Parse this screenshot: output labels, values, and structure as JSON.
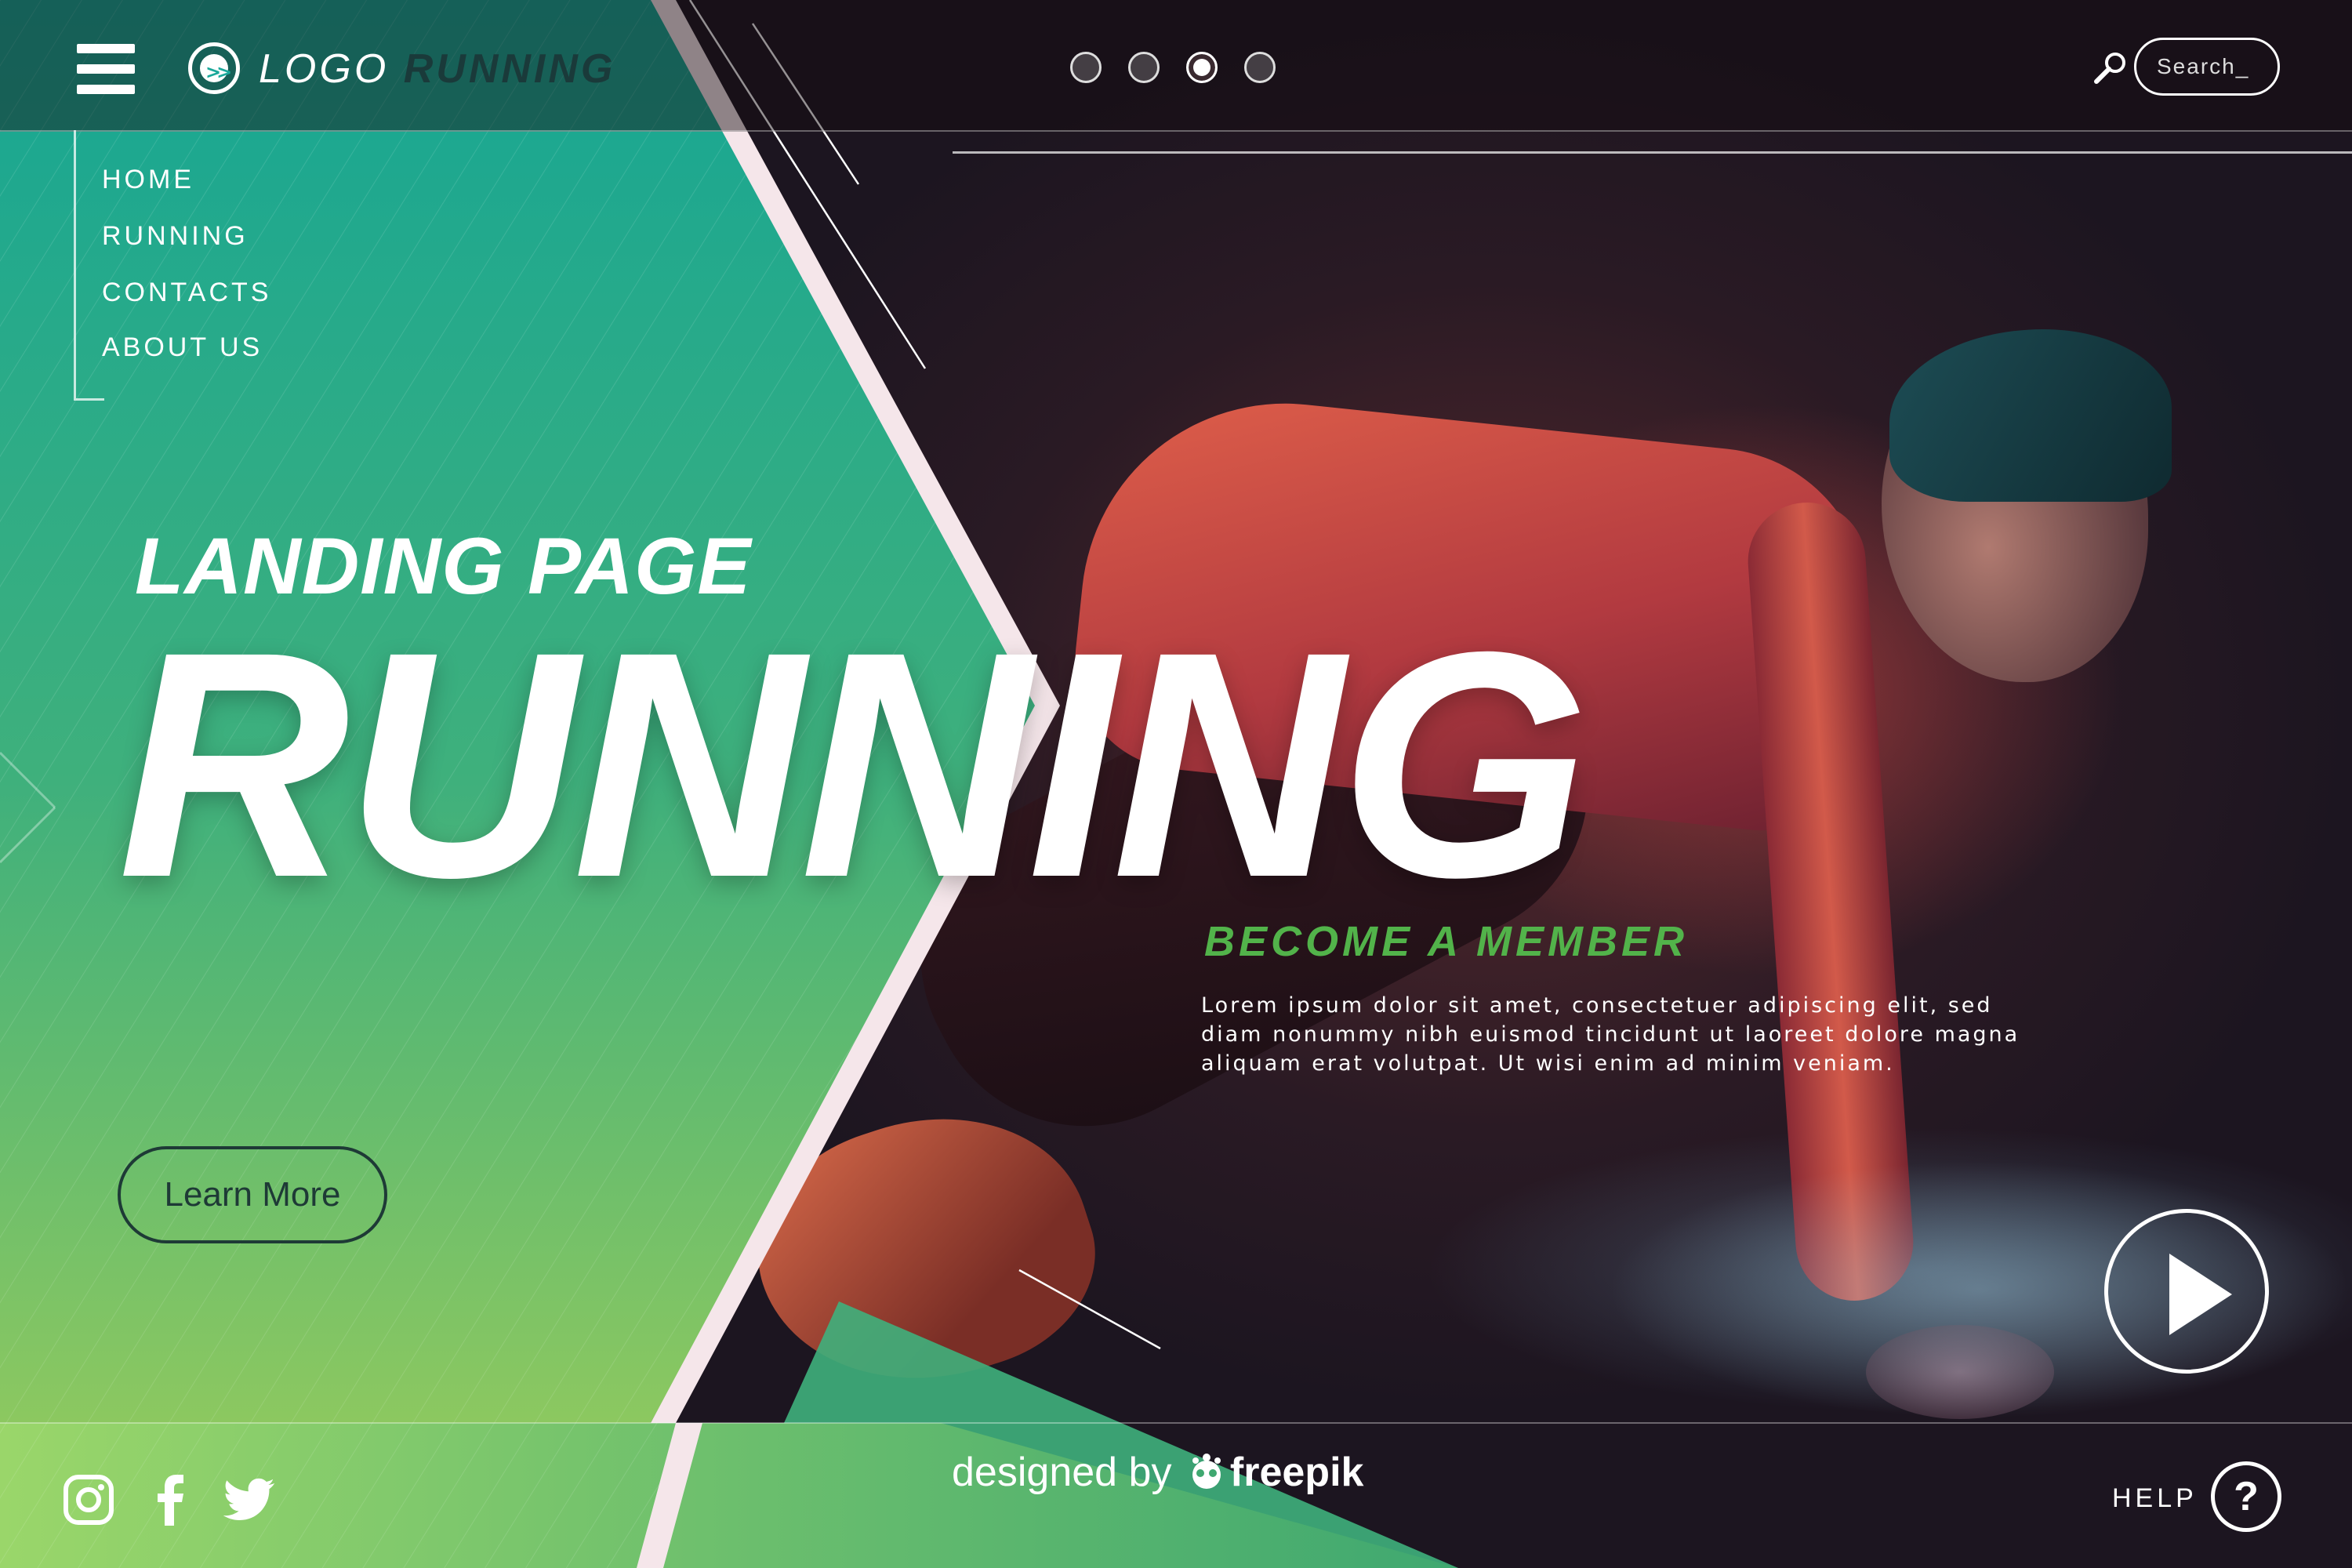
{
  "header": {
    "logo_light": "LOGO",
    "logo_bold": "RUNNING",
    "search_placeholder": "Search_",
    "carousel_dots": 4,
    "carousel_active_index": 3
  },
  "nav": {
    "items": [
      {
        "label": "HOME"
      },
      {
        "label": "RUNNING"
      },
      {
        "label": "CONTACTS"
      },
      {
        "label": "ABOUT US"
      }
    ]
  },
  "hero": {
    "subtitle": "LANDING PAGE",
    "title": "RUNNING",
    "member_heading": "BECOME A MEMBER",
    "body": "Lorem ipsum dolor sit amet, consectetuer adipiscing elit, sed diam nonummy nibh euismod tincidunt ut laoreet dolore magna aliquam erat volutpat. Ut wisi enim ad minim veniam.",
    "cta_label": "Learn More"
  },
  "footer": {
    "credit_prefix": "designed by",
    "credit_brand": "freepik",
    "help_label": "HELP",
    "help_symbol": "?",
    "social": [
      "instagram-icon",
      "facebook-icon",
      "twitter-icon"
    ]
  },
  "colors": {
    "teal_top": "#18a894",
    "green_mid": "#4cb87a",
    "green_bottom": "#8cc860",
    "member_green": "#52b34a",
    "dark_text": "#1e3a36"
  }
}
